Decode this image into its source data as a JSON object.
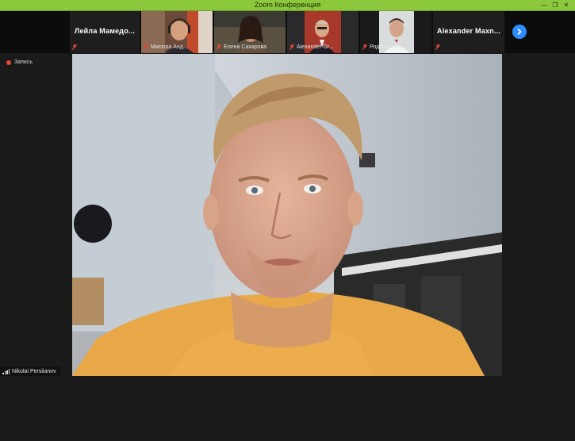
{
  "window": {
    "title": "Zoom Конференция",
    "minimize_glyph": "—",
    "restore_glyph": "❐",
    "close_glyph": "✕"
  },
  "participants": [
    {
      "name": "Лейла Мамедо...",
      "video": false,
      "muted": true
    },
    {
      "name": "Мисюра Анд...",
      "video": true,
      "muted": true
    },
    {
      "name": "Елена Сахарова",
      "video": true,
      "muted": true
    },
    {
      "name": "Alexander Gr...",
      "video": true,
      "muted": true
    },
    {
      "name": "Родион Цал...",
      "video": true,
      "muted": true
    },
    {
      "name": "Alexander Maxn...",
      "video": false,
      "muted": true
    }
  ],
  "recording": {
    "label": "Запись",
    "color": "#e8453c"
  },
  "active_speaker": {
    "name": "Nikolai Persiianov"
  },
  "icons": {
    "scroll": "chevron-right-icon",
    "mic": "muted-mic-icon",
    "audio": "audio-level-icon"
  },
  "colors": {
    "titlebar": "#8cc83c",
    "accent": "#2d8cff",
    "muted_icon": "#e8453c"
  }
}
